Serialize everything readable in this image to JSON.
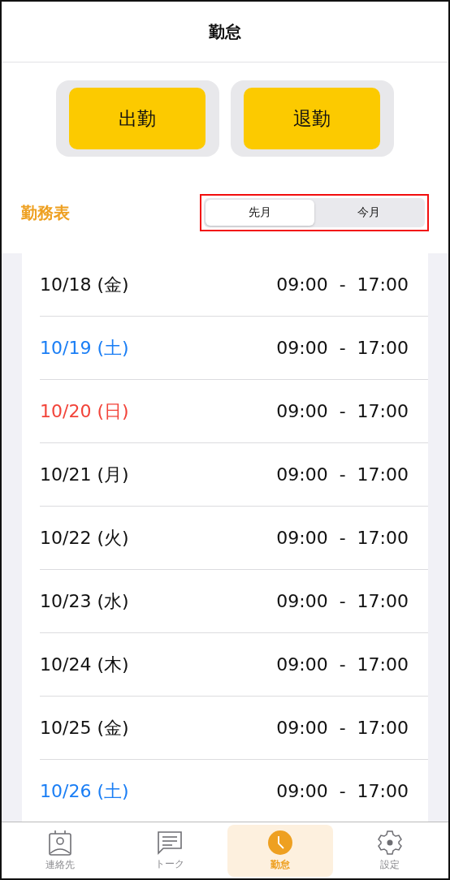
{
  "header": {
    "title": "勤怠"
  },
  "actions": [
    {
      "label": "出勤"
    },
    {
      "label": "退勤"
    }
  ],
  "schedule": {
    "title": "勤務表",
    "segments": [
      {
        "label": "先月",
        "selected": true
      },
      {
        "label": "今月",
        "selected": false
      }
    ],
    "rows": [
      {
        "date": "10/18 (金)",
        "kind": "weekday",
        "time": "09:00  -  17:00"
      },
      {
        "date": "10/19 (土)",
        "kind": "saturday",
        "time": "09:00  -  17:00"
      },
      {
        "date": "10/20 (日)",
        "kind": "sunday",
        "time": "09:00  -  17:00"
      },
      {
        "date": "10/21 (月)",
        "kind": "weekday",
        "time": "09:00  -  17:00"
      },
      {
        "date": "10/22 (火)",
        "kind": "weekday",
        "time": "09:00  -  17:00"
      },
      {
        "date": "10/23 (水)",
        "kind": "weekday",
        "time": "09:00  -  17:00"
      },
      {
        "date": "10/24 (木)",
        "kind": "weekday",
        "time": "09:00  -  17:00"
      },
      {
        "date": "10/25 (金)",
        "kind": "weekday",
        "time": "09:00  -  17:00"
      },
      {
        "date": "10/26 (土)",
        "kind": "saturday",
        "time": "09:00  -  17:00"
      }
    ]
  },
  "tab_bar": [
    {
      "label": "連絡先",
      "kind": "contacts",
      "selected": false
    },
    {
      "label": "トーク",
      "kind": "talk",
      "selected": false
    },
    {
      "label": "勤怠",
      "kind": "clock",
      "selected": true
    },
    {
      "label": "設定",
      "kind": "settings",
      "selected": false
    }
  ]
}
